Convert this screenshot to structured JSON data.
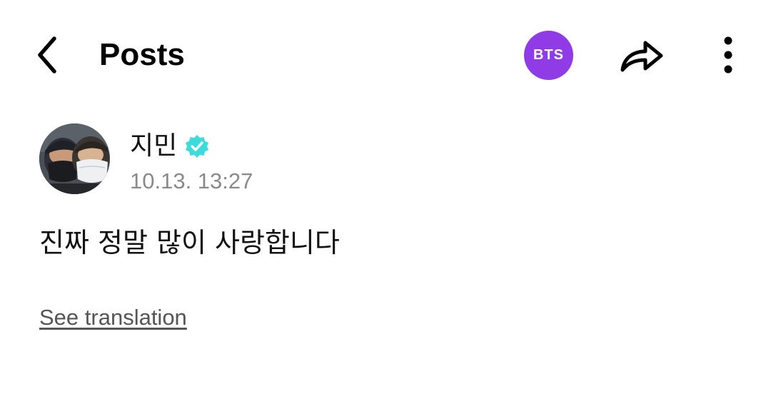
{
  "header": {
    "title": "Posts",
    "back_icon": "chevron-left-icon",
    "community_badge": {
      "label": "BTS",
      "color": "#8f3ce6"
    },
    "share_icon": "share-arrow-icon",
    "more_icon": "more-vertical-icon"
  },
  "post": {
    "author": {
      "name": "지민",
      "verified": true,
      "verified_color": "#3ddbdb"
    },
    "timestamp": "10.13. 13:27",
    "body": "진짜 정말 많이 사랑합니다",
    "see_translation_label": "See translation"
  }
}
